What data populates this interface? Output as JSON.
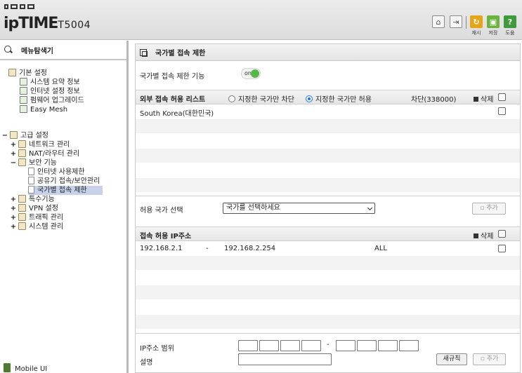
{
  "header": {
    "logo_main": "ipTIME",
    "logo_model": "T5004",
    "tools": [
      {
        "icon": "home-icon",
        "label": ""
      },
      {
        "icon": "logout-icon",
        "label": ""
      },
      {
        "icon": "restart-icon",
        "label": "재시",
        "color": "#e5a51b"
      },
      {
        "icon": "save-icon",
        "label": "저장",
        "color": "#6bb33f"
      },
      {
        "icon": "help-icon",
        "label": "도움",
        "color": "#3e9a3a"
      }
    ]
  },
  "sidebar": {
    "title": "메뉴탐색기",
    "basic": {
      "label": "기본 설정",
      "items": [
        "시스템 요약 정보",
        "인터넷 설정 정보",
        "펌웨어 업그레이드",
        "Easy Mesh"
      ]
    },
    "advanced": {
      "label": "고급 설정",
      "network": "네트워크 관리",
      "nat": "NAT/라우터 관리",
      "security": "보안 기능",
      "security_items": [
        "인터넷 사용제한",
        "공유기 접속/보안관리",
        "국가별 접속 제한"
      ],
      "special": "특수기능",
      "vpn": "VPN 설정",
      "traffic": "트래픽 관리",
      "system": "시스템 관리"
    },
    "mobile": "Mobile UI"
  },
  "main": {
    "title": "국가별 접속 제한",
    "feature_label": "국가별 접속 제한 기능",
    "toggle": "on",
    "list_title": "외부 접속 허용 리스트",
    "radio_block": "지정한 국가만 차단",
    "radio_allow": "지정한 국가만 허용",
    "block_count": "차단(338000)",
    "delete_label": "삭제",
    "countries": [
      "South Korea(대한민국)"
    ],
    "select_label": "허용 국가 선택",
    "select_placeholder": "국가를 선택하세요",
    "add_label": "추가",
    "ip_section_title": "접속 허용 IP주소",
    "ip_rows": [
      {
        "start": "192.168.2.1",
        "sep": "-",
        "end": "192.168.2.254",
        "type": "ALL"
      }
    ],
    "ip_range_label": "IP주소 범위",
    "ip_range_sep": "-",
    "desc_label": "설명",
    "reset_label": "새규칙",
    "add2_label": "추가"
  }
}
